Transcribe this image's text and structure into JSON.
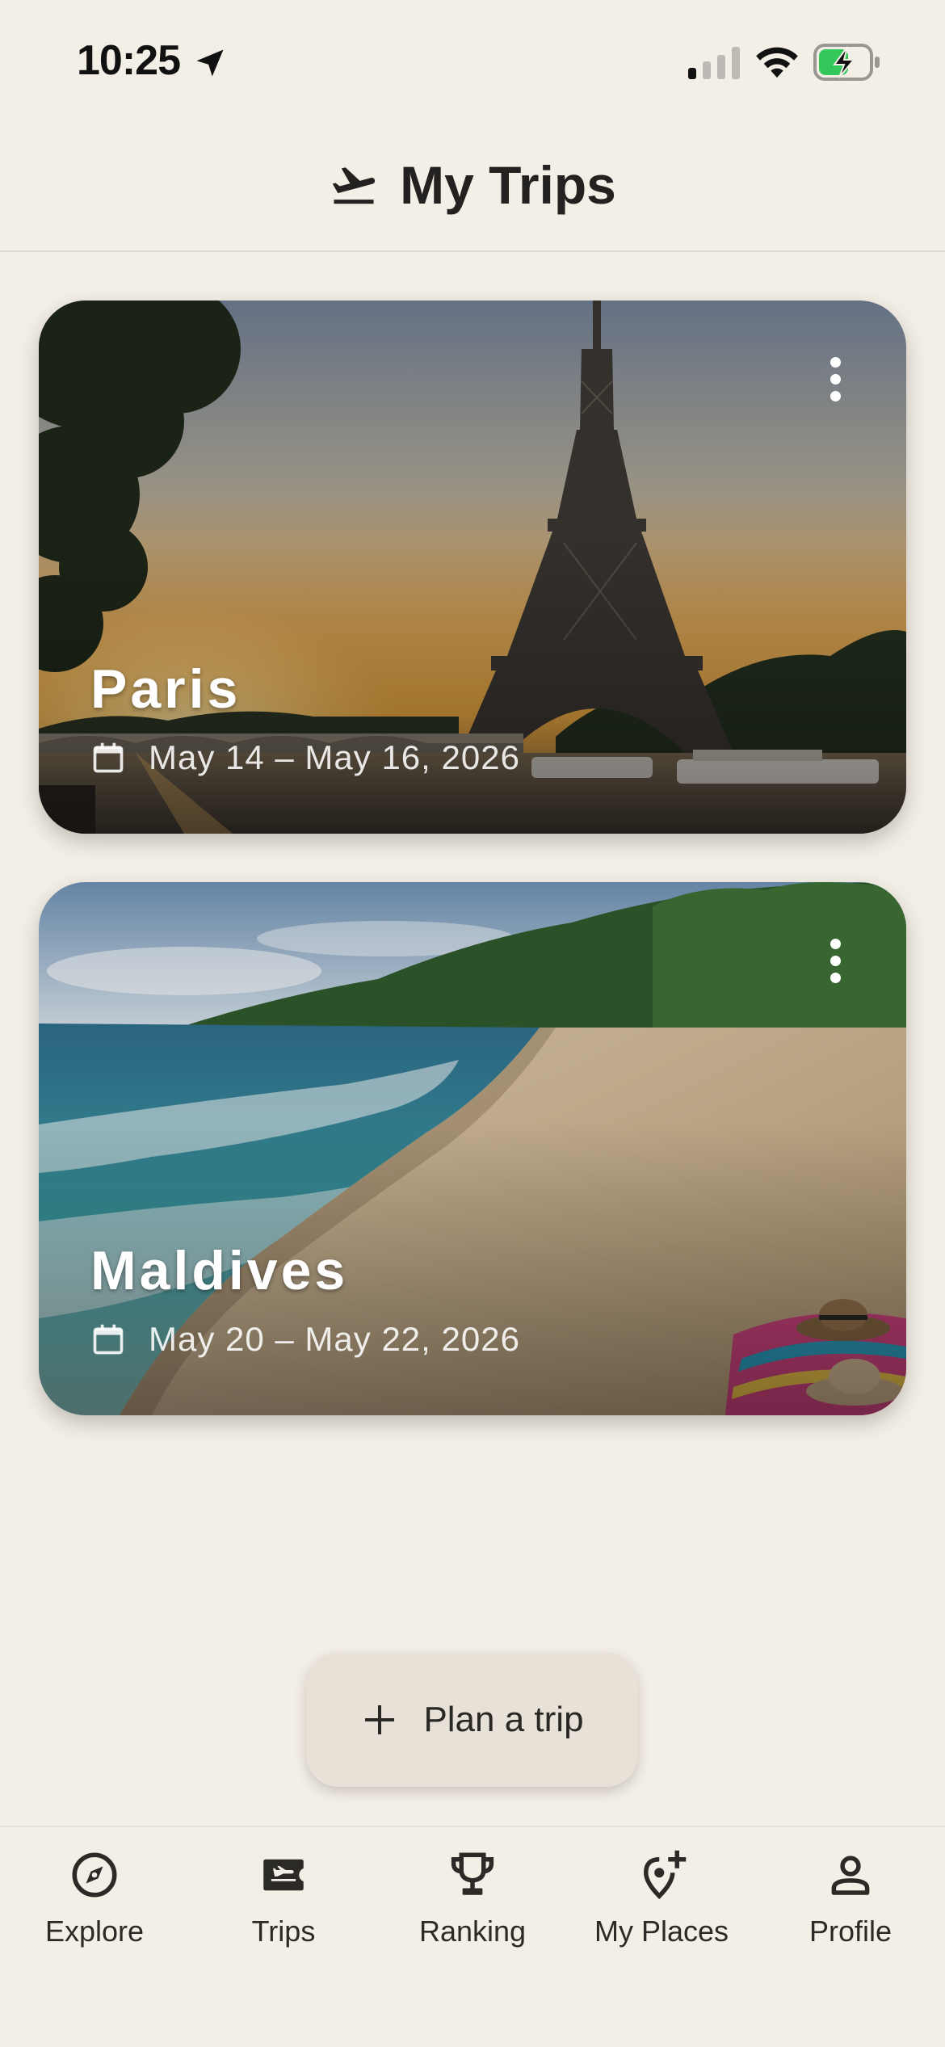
{
  "status_bar": {
    "time": "10:25"
  },
  "header": {
    "title": "My Trips",
    "icon": "flight-takeoff-icon"
  },
  "trips": [
    {
      "name": "Paris",
      "dates": "May 14 – May 16, 2026",
      "image": "eiffel-tower-sunset"
    },
    {
      "name": "Maldives",
      "dates": "May 20 – May 22, 2026",
      "image": "tropical-beach"
    }
  ],
  "fab": {
    "label": "Plan a trip",
    "icon": "plus-icon"
  },
  "bottom_nav": {
    "items": [
      {
        "label": "Explore",
        "icon": "compass-icon"
      },
      {
        "label": "Trips",
        "icon": "airplane-ticket-icon",
        "active": true
      },
      {
        "label": "Ranking",
        "icon": "trophy-icon"
      },
      {
        "label": "My Places",
        "icon": "add-location-icon"
      },
      {
        "label": "Profile",
        "icon": "person-icon"
      }
    ]
  },
  "colors": {
    "background": "#F4EFE6",
    "fab_background": "#E7E1D7",
    "text_primary": "#1F1D1A"
  }
}
